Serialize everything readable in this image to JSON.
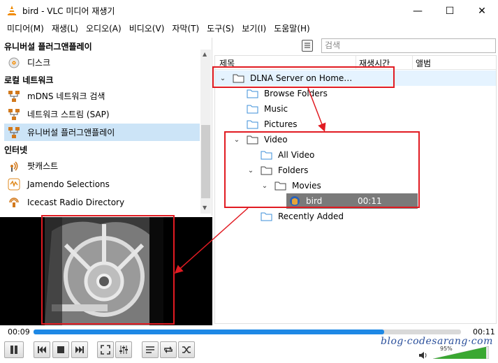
{
  "window": {
    "title": "bird - VLC 미디어 재생기",
    "minimize_glyph": "—",
    "maximize_glyph": "☐",
    "close_glyph": "✕"
  },
  "menu": [
    "미디어(M)",
    "재생(L)",
    "오디오(A)",
    "비디오(V)",
    "자막(T)",
    "도구(S)",
    "보기(I)",
    "도움말(H)"
  ],
  "sidebar": {
    "categories": {
      "upnp": "유니버설 플러그앤플레이",
      "local_network": "로컬 네트워크",
      "internet": "인터넷"
    },
    "items": [
      {
        "label": "디스크",
        "icon": "disc-icon"
      },
      {
        "label": "mDNS 네트워크 검색",
        "icon": "network-icon"
      },
      {
        "label": "네트워크 스트림 (SAP)",
        "icon": "network-icon"
      },
      {
        "label": "유니버설 플러그앤플레이",
        "icon": "network-icon",
        "selected": true
      },
      {
        "label": "팟캐스트",
        "icon": "podcast-icon"
      },
      {
        "label": "Jamendo Selections",
        "icon": "jamendo-icon"
      },
      {
        "label": "Icecast Radio Directory",
        "icon": "radio-icon"
      }
    ]
  },
  "search": {
    "placeholder": "검색"
  },
  "tree": {
    "columns": [
      "제목",
      "재생시간",
      "앨범"
    ],
    "rows": [
      {
        "label": "DLNA Server on Home…",
        "expanded": true
      },
      {
        "label": "Browse Folders"
      },
      {
        "label": "Music"
      },
      {
        "label": "Pictures"
      },
      {
        "label": "Video",
        "expanded": true
      },
      {
        "label": "All Video"
      },
      {
        "label": "Folders",
        "expanded": true
      },
      {
        "label": "Movies",
        "expanded": true
      },
      {
        "label": "bird",
        "duration": "00:11",
        "highlighted": true
      },
      {
        "label": "Recently Added"
      }
    ]
  },
  "playback": {
    "elapsed": "00:09",
    "total": "00:11",
    "progress": 0.82,
    "volume_percent": "95%",
    "volume_level": 0.95
  },
  "watermark": "blog·codesarang·com",
  "colors": {
    "annotation_red": "#e11b22",
    "seek_blue": "#1e88e5",
    "selection": "#cce4f7",
    "highlight_row": "#7a7a7a",
    "vlc_orange": "#f08a00"
  }
}
